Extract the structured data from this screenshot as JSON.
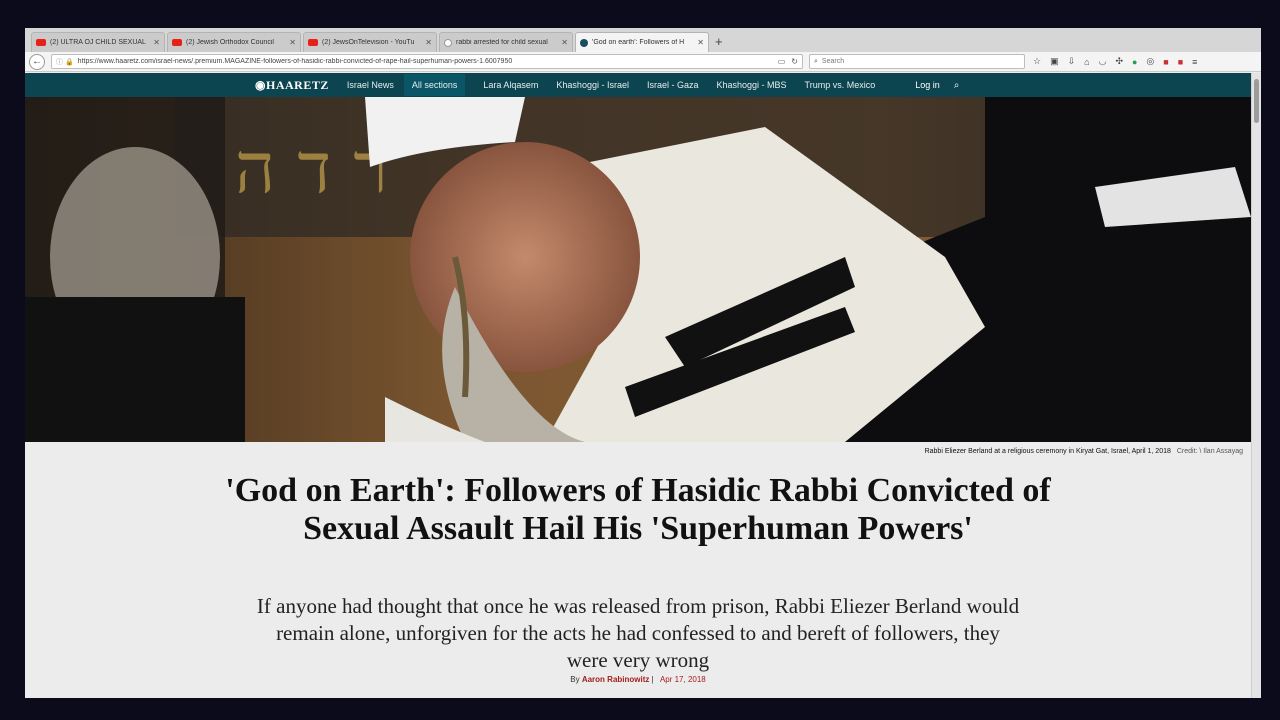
{
  "browser": {
    "tabs": [
      {
        "label": "(2) ULTRA OJ CHILD SEXUAL",
        "favicon": "youtube-icon",
        "active": false
      },
      {
        "label": "(2) Jewish Orthodox Council",
        "favicon": "youtube-icon",
        "active": false
      },
      {
        "label": "(2) JewsOnTelevision - YouTu",
        "favicon": "youtube-icon",
        "active": false
      },
      {
        "label": "rabbi arrested for child sexual",
        "favicon": "google-icon",
        "active": false
      },
      {
        "label": "'God on earth': Followers of H",
        "favicon": "haaretz-icon",
        "active": true
      }
    ],
    "new_tab": "+",
    "url": "https://www.haaretz.com/israel-news/.premium.MAGAZINE-followers-of-hasidic-rabbi-convicted-of-rape-hail-superhuman-powers-1.6007950",
    "search_placeholder": "Search"
  },
  "site_nav": {
    "logo": "HAARETZ",
    "items": [
      "Israel News",
      "All sections",
      "Lara Alqasem",
      "Khashoggi - Israel",
      "Israel - Gaza",
      "Khashoggi - MBS",
      "Trump vs. Mexico"
    ],
    "login": "Log in"
  },
  "article": {
    "caption": "Rabbi Eliezer Berland at a religious ceremony in Kiryat Gat, Israel, April 1, 2018",
    "credit": "Credit: \\ Ilan Assayag",
    "headline": "'God on Earth': Followers of Hasidic Rabbi Convicted of Sexual Assault Hail His 'Superhuman Powers'",
    "subhead": "If anyone had thought that once he was released from prison, Rabbi Eliezer Berland would remain alone, unforgiven for the acts he had confessed to and bereft of followers, they were very wrong",
    "byline_prefix": "By",
    "author": "Aaron Rabinowitz",
    "date": "Apr 17, 2018"
  },
  "colors": {
    "nav_bg": "#0c4450",
    "accent_red": "#a31d1d"
  }
}
